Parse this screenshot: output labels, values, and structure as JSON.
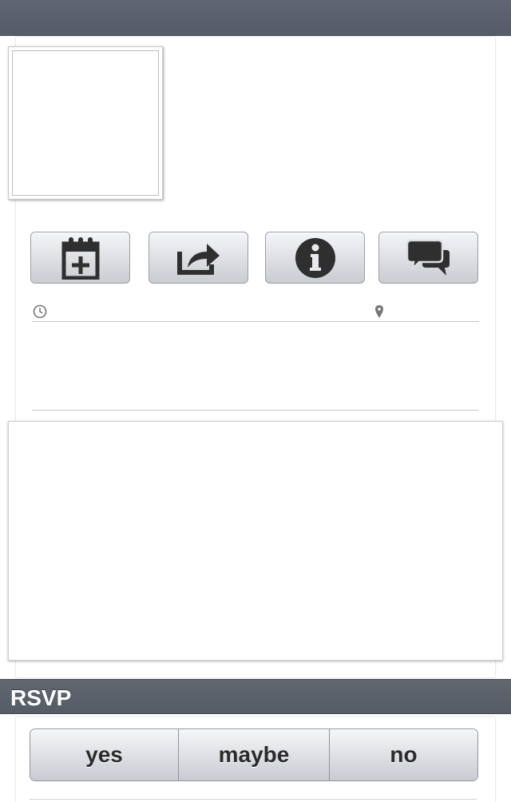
{
  "actions": {
    "add_to_calendar_icon": "calendar-add-icon",
    "share_icon": "share-icon",
    "info_icon": "info-icon",
    "comments_icon": "chat-bubbles-icon"
  },
  "event": {
    "time_icon": "clock-icon",
    "location_icon": "map-pin-icon",
    "time": "",
    "location": ""
  },
  "rsvp": {
    "header": "RSVP",
    "options": [
      "yes",
      "maybe",
      "no"
    ]
  },
  "colors": {
    "header_bar": "#5a616c",
    "button_top": "#f4f5f7",
    "button_bottom": "#c9ccd2",
    "icon": "#2f2f2f"
  }
}
